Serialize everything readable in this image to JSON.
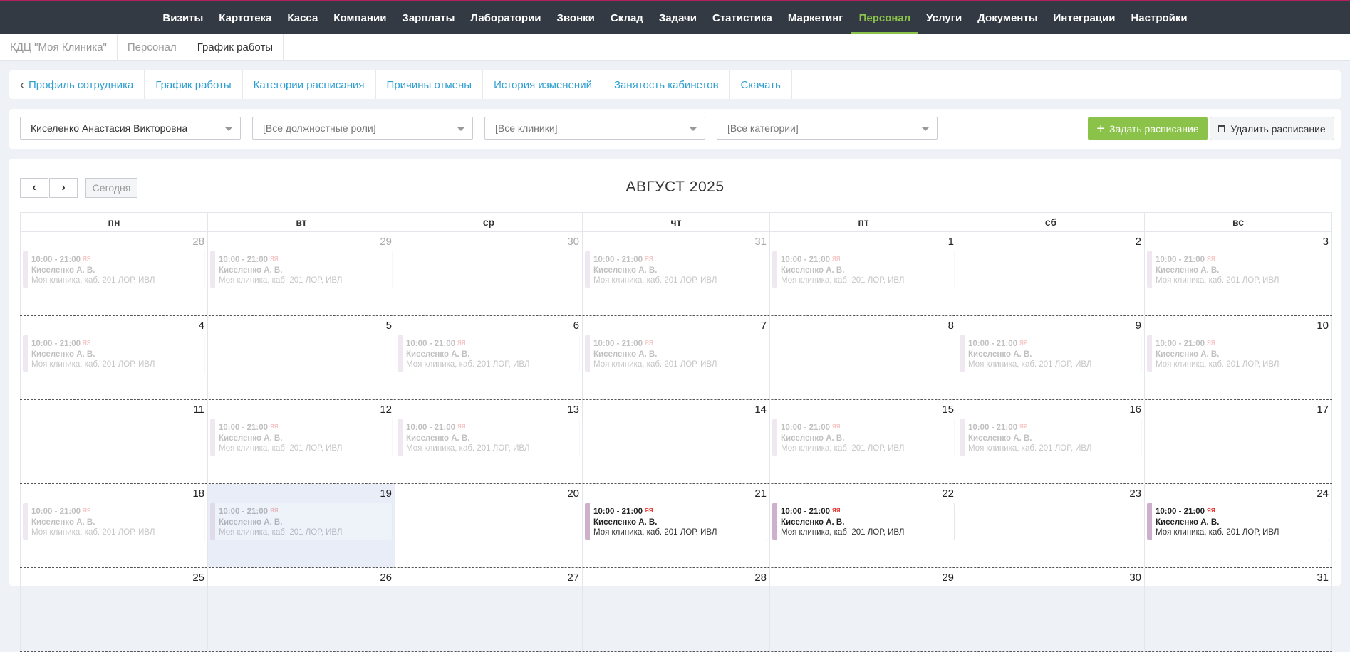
{
  "topnav": [
    "Визиты",
    "Картотека",
    "Касса",
    "Компании",
    "Зарплаты",
    "Лаборатории",
    "Звонки",
    "Склад",
    "Задачи",
    "Статистика",
    "Маркетинг",
    "Персонал",
    "Услуги",
    "Документы",
    "Интеграции",
    "Настройки"
  ],
  "topnav_active": "Персонал",
  "breadcrumbs": [
    "КДЦ \"Моя Клиника\"",
    "Персонал",
    "График работы"
  ],
  "tabs": [
    "Профиль сотрудника",
    "График работы",
    "Категории расписания",
    "Причины отмены",
    "История изменений",
    "Занятость кабинетов",
    "Скачать"
  ],
  "filters": {
    "employee": "Киселенко Анастасия Викторовна",
    "roles": "[Все должностные роли]",
    "clinics": "[Все клиники]",
    "categories": "[Все категории]",
    "add_label": "Задать расписание",
    "delete_label": "Удалить расписание"
  },
  "calendar": {
    "prev": "‹",
    "next": "›",
    "today_label": "Сегодня",
    "title": "АВГУСТ 2025",
    "weekdays": [
      "пн",
      "вт",
      "ср",
      "чт",
      "пт",
      "сб",
      "вс"
    ],
    "event": {
      "time": "10:00 - 21:00",
      "icon_text": "ЯЯ",
      "name": "Киселенко А. В.",
      "location": "Моя клиника, каб. 201 ЛОР, ИВЛ"
    },
    "today_day": 19,
    "weeks": [
      [
        {
          "d": 28,
          "other": true,
          "ev": true,
          "past": true
        },
        {
          "d": 29,
          "other": true,
          "ev": true,
          "past": true
        },
        {
          "d": 30,
          "other": true,
          "ev": false,
          "past": true
        },
        {
          "d": 31,
          "other": true,
          "ev": true,
          "past": true
        },
        {
          "d": 1,
          "ev": true,
          "past": true
        },
        {
          "d": 2,
          "ev": false,
          "past": true
        },
        {
          "d": 3,
          "ev": true,
          "past": true
        }
      ],
      [
        {
          "d": 4,
          "ev": true,
          "past": true
        },
        {
          "d": 5,
          "ev": false,
          "past": true
        },
        {
          "d": 6,
          "ev": true,
          "past": true
        },
        {
          "d": 7,
          "ev": true,
          "past": true
        },
        {
          "d": 8,
          "ev": false,
          "past": true
        },
        {
          "d": 9,
          "ev": true,
          "past": true
        },
        {
          "d": 10,
          "ev": true,
          "past": true
        }
      ],
      [
        {
          "d": 11,
          "ev": false,
          "past": true
        },
        {
          "d": 12,
          "ev": true,
          "past": true
        },
        {
          "d": 13,
          "ev": true,
          "past": true
        },
        {
          "d": 14,
          "ev": false,
          "past": true
        },
        {
          "d": 15,
          "ev": true,
          "past": true
        },
        {
          "d": 16,
          "ev": true,
          "past": true
        },
        {
          "d": 17,
          "ev": false,
          "past": true
        }
      ],
      [
        {
          "d": 18,
          "ev": true,
          "past": true
        },
        {
          "d": 19,
          "ev": true,
          "past": true,
          "today": true
        },
        {
          "d": 20,
          "ev": false,
          "past": false
        },
        {
          "d": 21,
          "ev": true,
          "past": false
        },
        {
          "d": 22,
          "ev": true,
          "past": false
        },
        {
          "d": 23,
          "ev": false,
          "past": false
        },
        {
          "d": 24,
          "ev": true,
          "past": false
        }
      ],
      [
        {
          "d": 25,
          "ev": false
        },
        {
          "d": 26,
          "ev": false
        },
        {
          "d": 27,
          "ev": false
        },
        {
          "d": 28,
          "ev": false
        },
        {
          "d": 29,
          "ev": false
        },
        {
          "d": 30,
          "ev": false
        },
        {
          "d": 31,
          "ev": false
        }
      ]
    ]
  }
}
